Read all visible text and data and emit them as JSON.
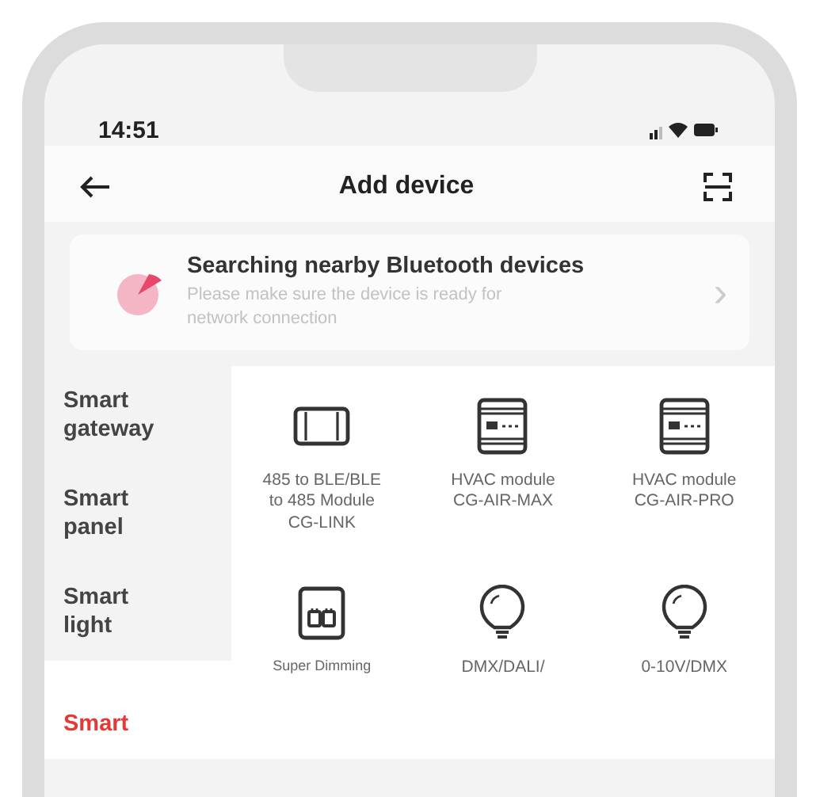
{
  "status_bar": {
    "time": "14:51"
  },
  "header": {
    "title": "Add device"
  },
  "bluetooth_card": {
    "title": "Searching nearby Bluetooth devices",
    "subtitle": "Please make sure the device is ready for network connection",
    "chevron": "›"
  },
  "sidebar": {
    "items": [
      {
        "label": "Smart\ngateway",
        "selected": false
      },
      {
        "label": "Smart\npanel",
        "selected": false
      },
      {
        "label": "Smart\nlight",
        "selected": false
      },
      {
        "label": "Smart",
        "selected": true
      }
    ]
  },
  "devices": [
    {
      "kind": "gateway",
      "label": "485 to BLE/BLE\nto 485 Module\nCG-LINK"
    },
    {
      "kind": "module",
      "label": "HVAC module\nCG-AIR-MAX"
    },
    {
      "kind": "module",
      "label": "HVAC module\nCG-AIR-PRO"
    },
    {
      "kind": "dimmer",
      "label": "Super Dimming"
    },
    {
      "kind": "bulb",
      "label": "DMX/DALI/"
    },
    {
      "kind": "bulb",
      "label": "0-10V/DMX"
    }
  ]
}
